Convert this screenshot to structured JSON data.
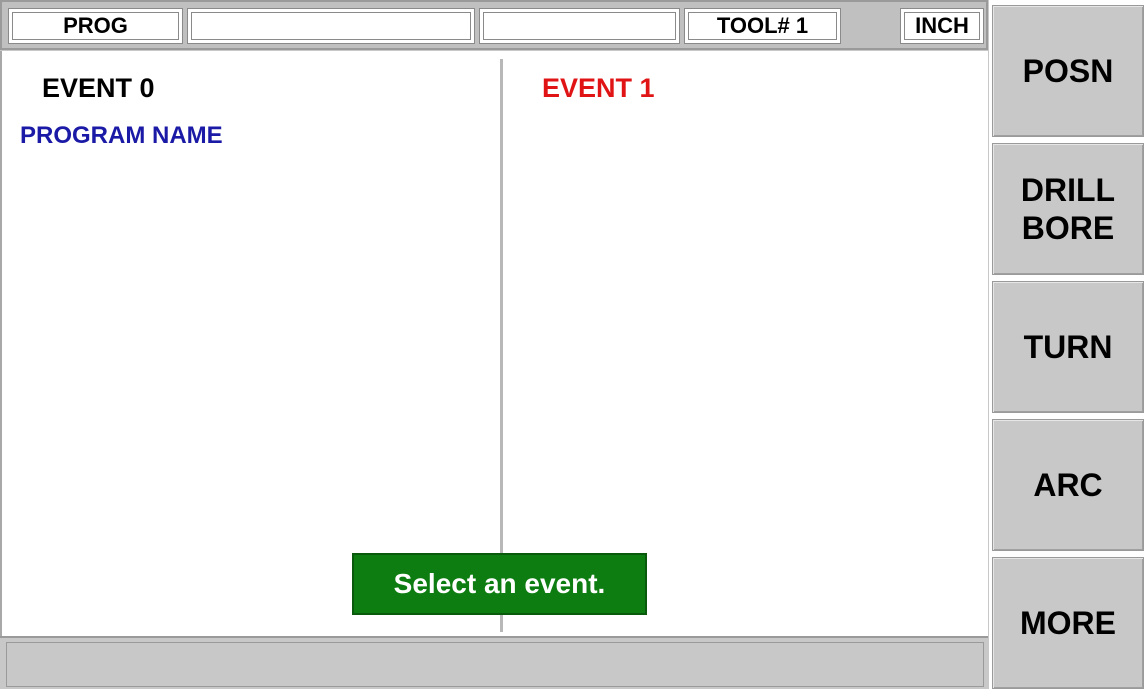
{
  "status_bar": {
    "mode": "PROG",
    "field2": "",
    "field3": "",
    "tool": "TOOL# 1",
    "units": "INCH"
  },
  "main": {
    "event0_title": "EVENT 0",
    "event0_label": "PROGRAM NAME",
    "event1_title": "EVENT 1",
    "message": "Select an event."
  },
  "bottom_bar": {
    "text": ""
  },
  "softkeys": {
    "posn": "POSN",
    "drill_line1": "DRILL",
    "drill_line2": "BORE",
    "turn": "TURN",
    "arc": "ARC",
    "more": "MORE"
  },
  "colors": {
    "event0": "#000000",
    "event1": "#e01414",
    "program_name": "#1a1aa6",
    "message_bg": "#0d7d12"
  }
}
